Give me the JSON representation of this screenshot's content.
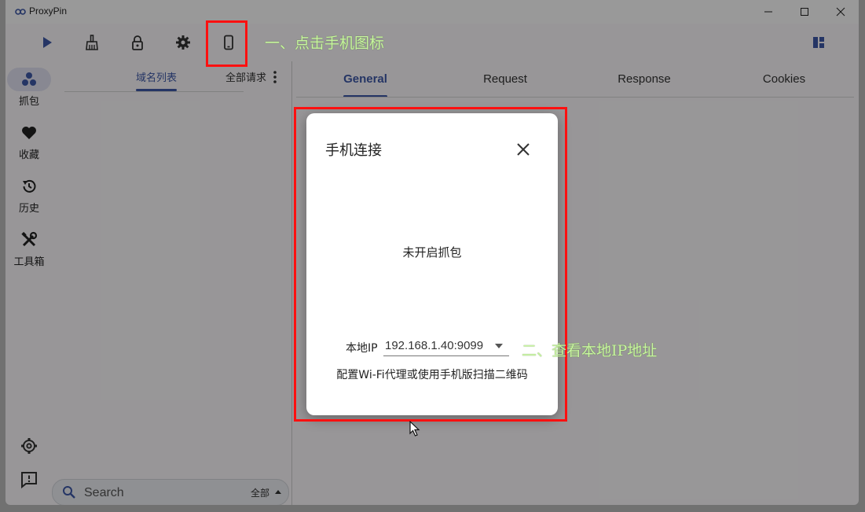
{
  "window": {
    "title": "ProxyPin",
    "accent_color": "#3e59a8"
  },
  "toolbar": {
    "icons": [
      "play-icon",
      "broom-icon",
      "lock-icon",
      "gear-icon",
      "phone-icon",
      "layout-icon"
    ]
  },
  "rail": {
    "items": [
      {
        "label": "抓包",
        "icon": "capture-icon"
      },
      {
        "label": "收藏",
        "icon": "heart-icon"
      },
      {
        "label": "历史",
        "icon": "history-icon"
      },
      {
        "label": "工具箱",
        "icon": "tools-icon"
      }
    ],
    "bottom_icons": [
      "settings-icon",
      "feedback-icon"
    ]
  },
  "left_panel": {
    "tabs": [
      {
        "label": "域名列表",
        "active": true
      },
      {
        "label": "全部请求",
        "active": false
      }
    ]
  },
  "search": {
    "placeholder": "Search",
    "filter": "全部"
  },
  "right_panel": {
    "tabs": [
      {
        "label": "General",
        "active": true
      },
      {
        "label": "Request",
        "active": false
      },
      {
        "label": "Response",
        "active": false
      },
      {
        "label": "Cookies",
        "active": false
      }
    ]
  },
  "dialog": {
    "title": "手机连接",
    "status": "未开启抓包",
    "ip_label": "本地IP",
    "ip_value": "192.168.1.40:9099",
    "hint": "配置Wi-Fi代理或使用手机版扫描二维码"
  },
  "annotations": {
    "step1": "一、点击手机图标",
    "step2": "二、查看本地IP地址",
    "highlight_color": "#ff1010"
  }
}
